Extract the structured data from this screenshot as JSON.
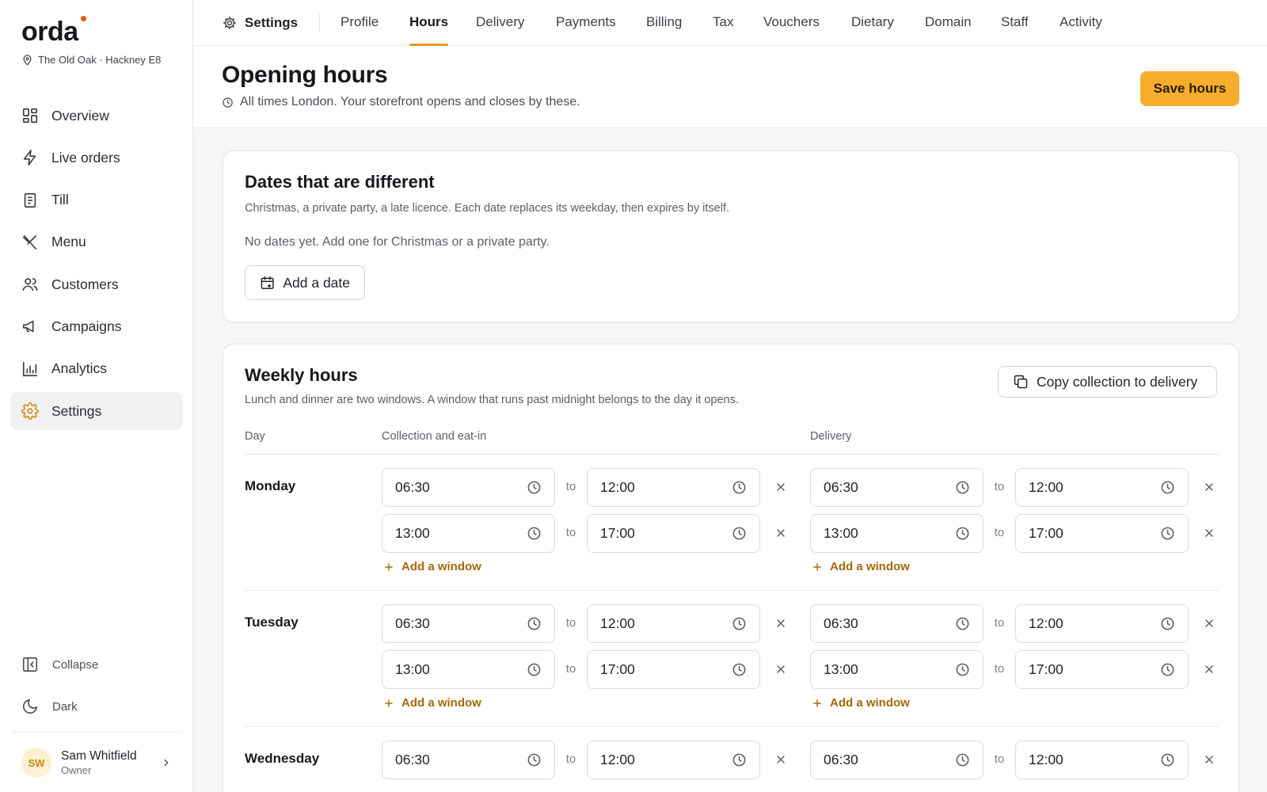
{
  "brand": {
    "name": "orda",
    "location": "The Old Oak · Hackney E8",
    "accent": "#e2561c"
  },
  "sidebar": {
    "items": [
      {
        "label": "Overview",
        "icon": "grid-icon"
      },
      {
        "label": "Live orders",
        "icon": "bolt-icon"
      },
      {
        "label": "Till",
        "icon": "receipt-icon"
      },
      {
        "label": "Menu",
        "icon": "utensils-icon"
      },
      {
        "label": "Customers",
        "icon": "users-icon"
      },
      {
        "label": "Campaigns",
        "icon": "megaphone-icon"
      },
      {
        "label": "Analytics",
        "icon": "bar-chart-icon"
      },
      {
        "label": "Settings",
        "icon": "gear-icon",
        "active": true
      }
    ],
    "collapse_label": "Collapse",
    "dark_label": "Dark",
    "user": {
      "initials": "SW",
      "name": "Sam Whitfield",
      "role": "Owner"
    }
  },
  "topbar": {
    "root_label": "Settings",
    "tabs": [
      "Profile",
      "Hours",
      "Delivery",
      "Payments",
      "Billing",
      "Tax",
      "Vouchers",
      "Dietary",
      "Domain",
      "Staff",
      "Activity"
    ],
    "active_tab": "Hours"
  },
  "header": {
    "title": "Opening hours",
    "subtitle": "All times London. Your storefront opens and closes by these.",
    "save_label": "Save hours",
    "save_color": "#f5ad2b"
  },
  "dates_card": {
    "title": "Dates that are different",
    "subtitle": "Christmas, a private party, a late licence. Each date replaces its weekday, then expires by itself.",
    "empty": "No dates yet. Add one for Christmas or a private party.",
    "add_label": "Add a date"
  },
  "weekly": {
    "title": "Weekly hours",
    "subtitle": "Lunch and dinner are two windows. A window that runs past midnight belongs to the day it opens.",
    "copy_label": "Copy collection to delivery",
    "col_day": "Day",
    "col_collection": "Collection and eat-in",
    "col_delivery": "Delivery",
    "to_label": "to",
    "add_window_label": "Add a window",
    "days": [
      {
        "name": "Monday",
        "collection": [
          {
            "from": "06:30",
            "to": "12:00"
          },
          {
            "from": "13:00",
            "to": "17:00"
          }
        ],
        "delivery": [
          {
            "from": "06:30",
            "to": "12:00"
          },
          {
            "from": "13:00",
            "to": "17:00"
          }
        ]
      },
      {
        "name": "Tuesday",
        "collection": [
          {
            "from": "06:30",
            "to": "12:00"
          },
          {
            "from": "13:00",
            "to": "17:00"
          }
        ],
        "delivery": [
          {
            "from": "06:30",
            "to": "12:00"
          },
          {
            "from": "13:00",
            "to": "17:00"
          }
        ]
      },
      {
        "name": "Wednesday",
        "collection": [
          {
            "from": "06:30",
            "to": "12:00"
          }
        ],
        "delivery": [
          {
            "from": "06:30",
            "to": "12:00"
          }
        ]
      }
    ]
  }
}
